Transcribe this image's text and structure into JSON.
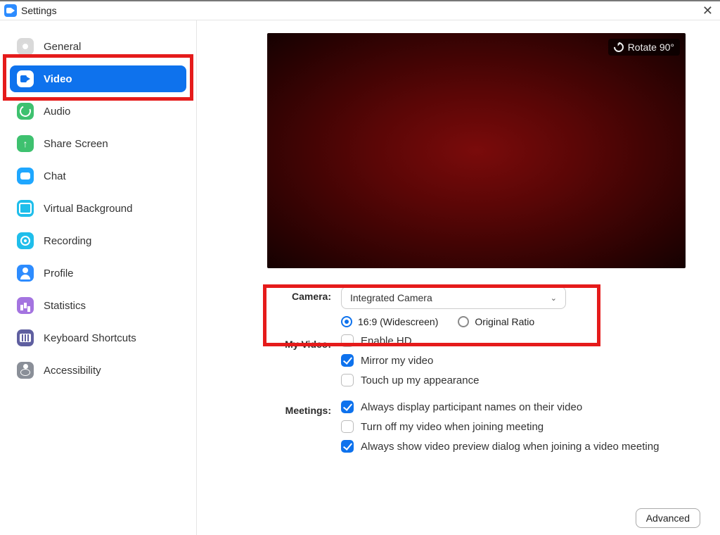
{
  "window": {
    "title": "Settings"
  },
  "sidebar": {
    "items": [
      {
        "label": "General"
      },
      {
        "label": "Video"
      },
      {
        "label": "Audio"
      },
      {
        "label": "Share Screen"
      },
      {
        "label": "Chat"
      },
      {
        "label": "Virtual Background"
      },
      {
        "label": "Recording"
      },
      {
        "label": "Profile"
      },
      {
        "label": "Statistics"
      },
      {
        "label": "Keyboard Shortcuts"
      },
      {
        "label": "Accessibility"
      }
    ]
  },
  "preview": {
    "rotate_label": "Rotate 90°"
  },
  "camera": {
    "label": "Camera:",
    "selected": "Integrated Camera",
    "ratio_widescreen": "16:9 (Widescreen)",
    "ratio_original": "Original Ratio"
  },
  "myvideo": {
    "label": "My Video:",
    "enable_hd": "Enable HD",
    "mirror": "Mirror my video",
    "touchup": "Touch up my appearance"
  },
  "meetings": {
    "label": "Meetings:",
    "show_names": "Always display participant names on their video",
    "turn_off": "Turn off my video when joining meeting",
    "preview": "Always show video preview dialog when joining a video meeting"
  },
  "footer": {
    "advanced": "Advanced"
  }
}
